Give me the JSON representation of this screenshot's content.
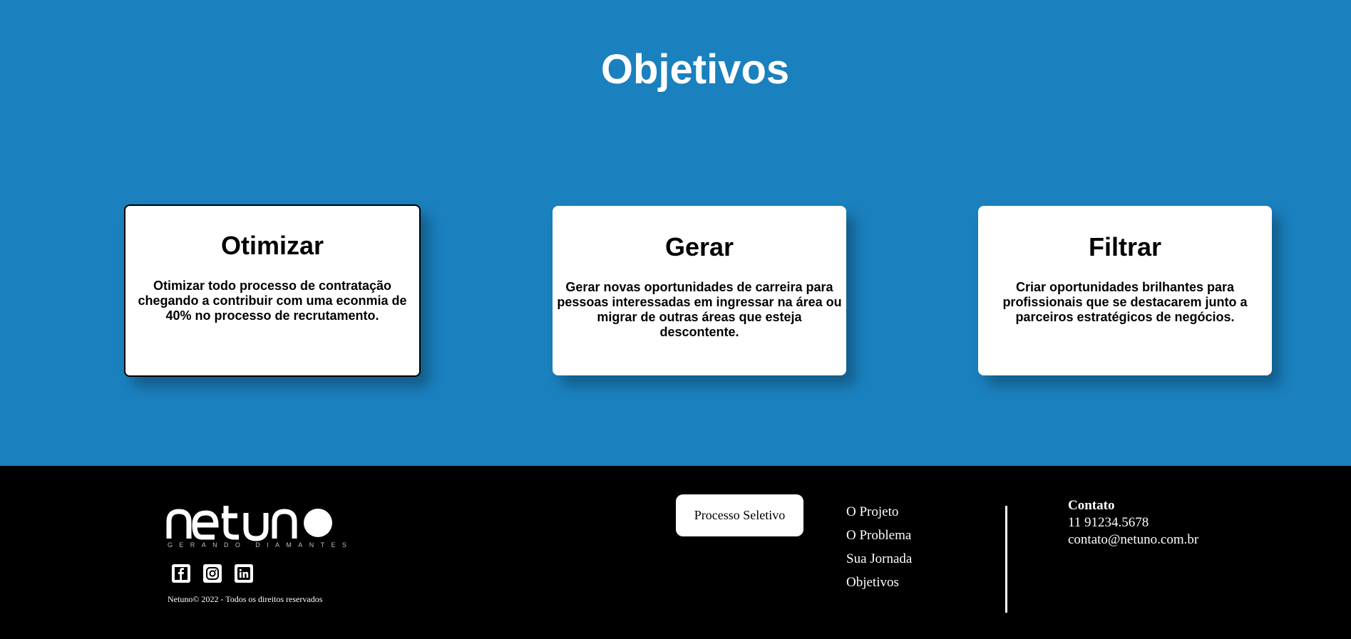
{
  "objectives": {
    "title": "Objetivos",
    "cards": [
      {
        "title": "Otimizar",
        "text": "Otimizar todo processo de contratação chegando a contribuir com uma econmia de 40% no processo de recrutamento."
      },
      {
        "title": "Gerar",
        "text": "Gerar novas oportunidades de carreira para pessoas interessadas em ingressar na área ou migrar de outras áreas que esteja descontente."
      },
      {
        "title": "Filtrar",
        "text": "Criar oportunidades brilhantes para profissionais que se destacarem junto a parceiros estratégicos de negócios."
      }
    ]
  },
  "footer": {
    "logo_text": "netuno",
    "tagline": "GERANDO DIAMANTES",
    "socials": [
      "facebook-icon",
      "instagram-icon",
      "linkedin-icon"
    ],
    "copyright": "Netuno© 2022 - Todos os direitos reservados",
    "cta_label": "Processo Seletivo",
    "nav": [
      "O Projeto",
      "O Problema",
      "Sua Jornada",
      "Objetivos"
    ],
    "contact": {
      "title": "Contato",
      "phone": "11 91234.5678",
      "email": "contato@netuno.com.br"
    }
  },
  "colors": {
    "primary_blue": "#1a80be",
    "footer_bg": "#000000",
    "card_bg": "#ffffff"
  }
}
